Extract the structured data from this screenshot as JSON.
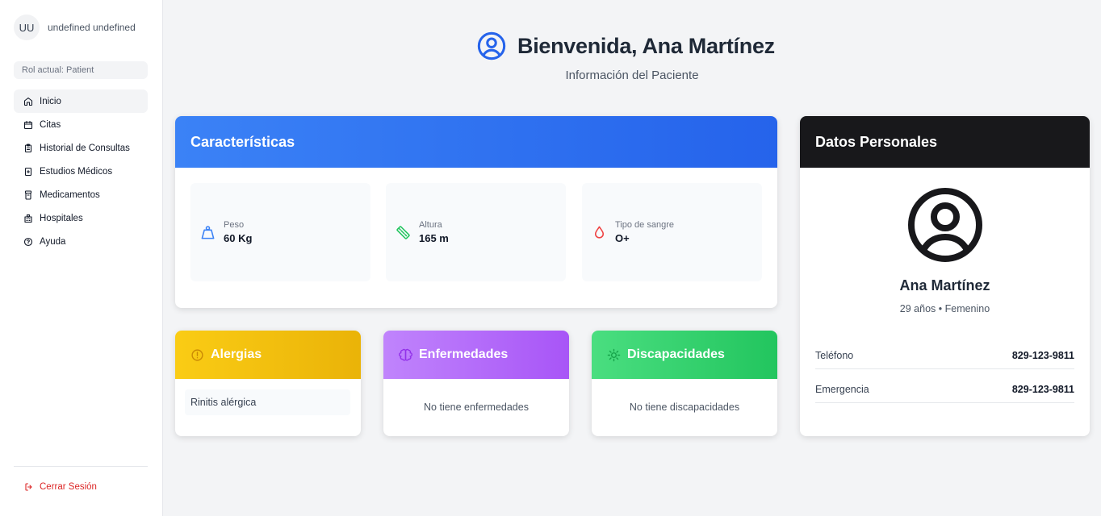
{
  "user": {
    "initials": "UU",
    "name": "undefined undefined",
    "role_label": "Rol actual: Patient"
  },
  "nav": [
    {
      "label": "Inicio",
      "icon": "home-icon",
      "active": true
    },
    {
      "label": "Citas",
      "icon": "calendar-icon",
      "active": false
    },
    {
      "label": "Historial de Consultas",
      "icon": "clipboard-icon",
      "active": false
    },
    {
      "label": "Estudios Médicos",
      "icon": "file-plus-icon",
      "active": false
    },
    {
      "label": "Medicamentos",
      "icon": "pill-bottle-icon",
      "active": false
    },
    {
      "label": "Hospitales",
      "icon": "hospital-icon",
      "active": false
    },
    {
      "label": "Ayuda",
      "icon": "help-circle-icon",
      "active": false
    }
  ],
  "logout_label": "Cerrar Sesión",
  "header": {
    "title": "Bienvenida, Ana Martínez",
    "subtitle": "Información del Paciente"
  },
  "characteristics": {
    "title": "Características",
    "metrics": [
      {
        "label": "Peso",
        "value": "60 Kg",
        "icon": "weight-icon",
        "color": "#3b82f6"
      },
      {
        "label": "Altura",
        "value": "165 m",
        "icon": "ruler-icon",
        "color": "#22c55e"
      },
      {
        "label": "Tipo de sangre",
        "value": "O+",
        "icon": "droplet-icon",
        "color": "#ef4444"
      }
    ]
  },
  "personal": {
    "title": "Datos Personales",
    "name": "Ana Martínez",
    "meta": "29 años • Femenino",
    "rows": [
      {
        "key": "Teléfono",
        "value": "829-123-9811"
      },
      {
        "key": "Emergencia",
        "value": "829-123-9811"
      }
    ]
  },
  "allergies": {
    "title": "Alergias",
    "items": [
      "Rinitis alérgica"
    ],
    "color": "#eab308"
  },
  "diseases": {
    "title": "Enfermedades",
    "empty": "No tiene enfermedades",
    "color": "#a855f7"
  },
  "disabilities": {
    "title": "Discapacidades",
    "empty": "No tiene discapacidades",
    "color": "#22c55e"
  },
  "colors": {
    "primary": "#2563eb",
    "dark": "#18181b",
    "danger": "#dc2626"
  }
}
